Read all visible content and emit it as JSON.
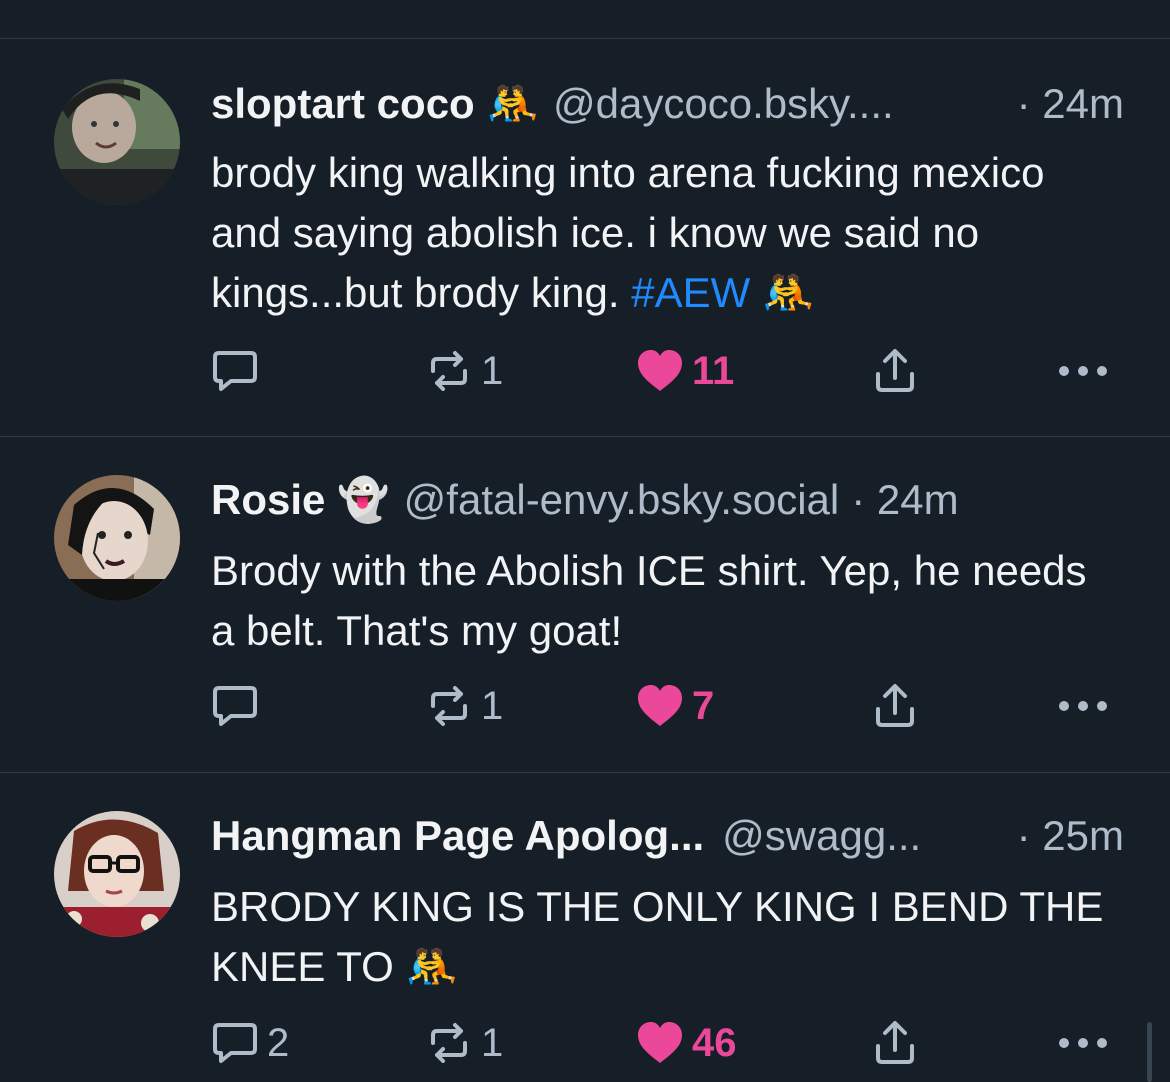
{
  "colors": {
    "background": "#161e27",
    "text": "#f1f3f5",
    "muted": "#aebbc9",
    "link": "#208bfe",
    "like": "#ec4899",
    "divider": "#2e3a48"
  },
  "posts": [
    {
      "author": "sloptart coco",
      "author_emoji": "🤼",
      "handle": "@daycoco.bsky....",
      "time": "· 24m",
      "text": "brody king walking into arena fucking mexico and saying abolish ice. i know we said no kings...but brody king. ",
      "hashtag": "#AEW",
      "text_emoji": "🤼",
      "replies": "",
      "reposts": "1",
      "likes": "11",
      "liked": true
    },
    {
      "author": "Rosie",
      "author_emoji": "👻",
      "handle": "@fatal-envy.bsky.social",
      "time": "· 24m",
      "text": "Brody with the Abolish ICE shirt. Yep, he needs a belt. That's my goat!",
      "replies": "",
      "reposts": "1",
      "likes": "7",
      "liked": true
    },
    {
      "author": "Hangman Page Apolog...",
      "handle": "@swagg...",
      "time": "· 25m",
      "text": "BRODY KING IS THE ONLY KING I BEND THE KNEE TO ",
      "text_emoji": "🤼",
      "replies": "2",
      "reposts": "1",
      "likes": "46",
      "liked": true
    }
  ],
  "icons": {
    "reply": "speech-bubble-icon",
    "repost": "repost-arrows-icon",
    "like": "heart-icon",
    "share": "share-upload-icon",
    "more": "more-dots-icon"
  }
}
